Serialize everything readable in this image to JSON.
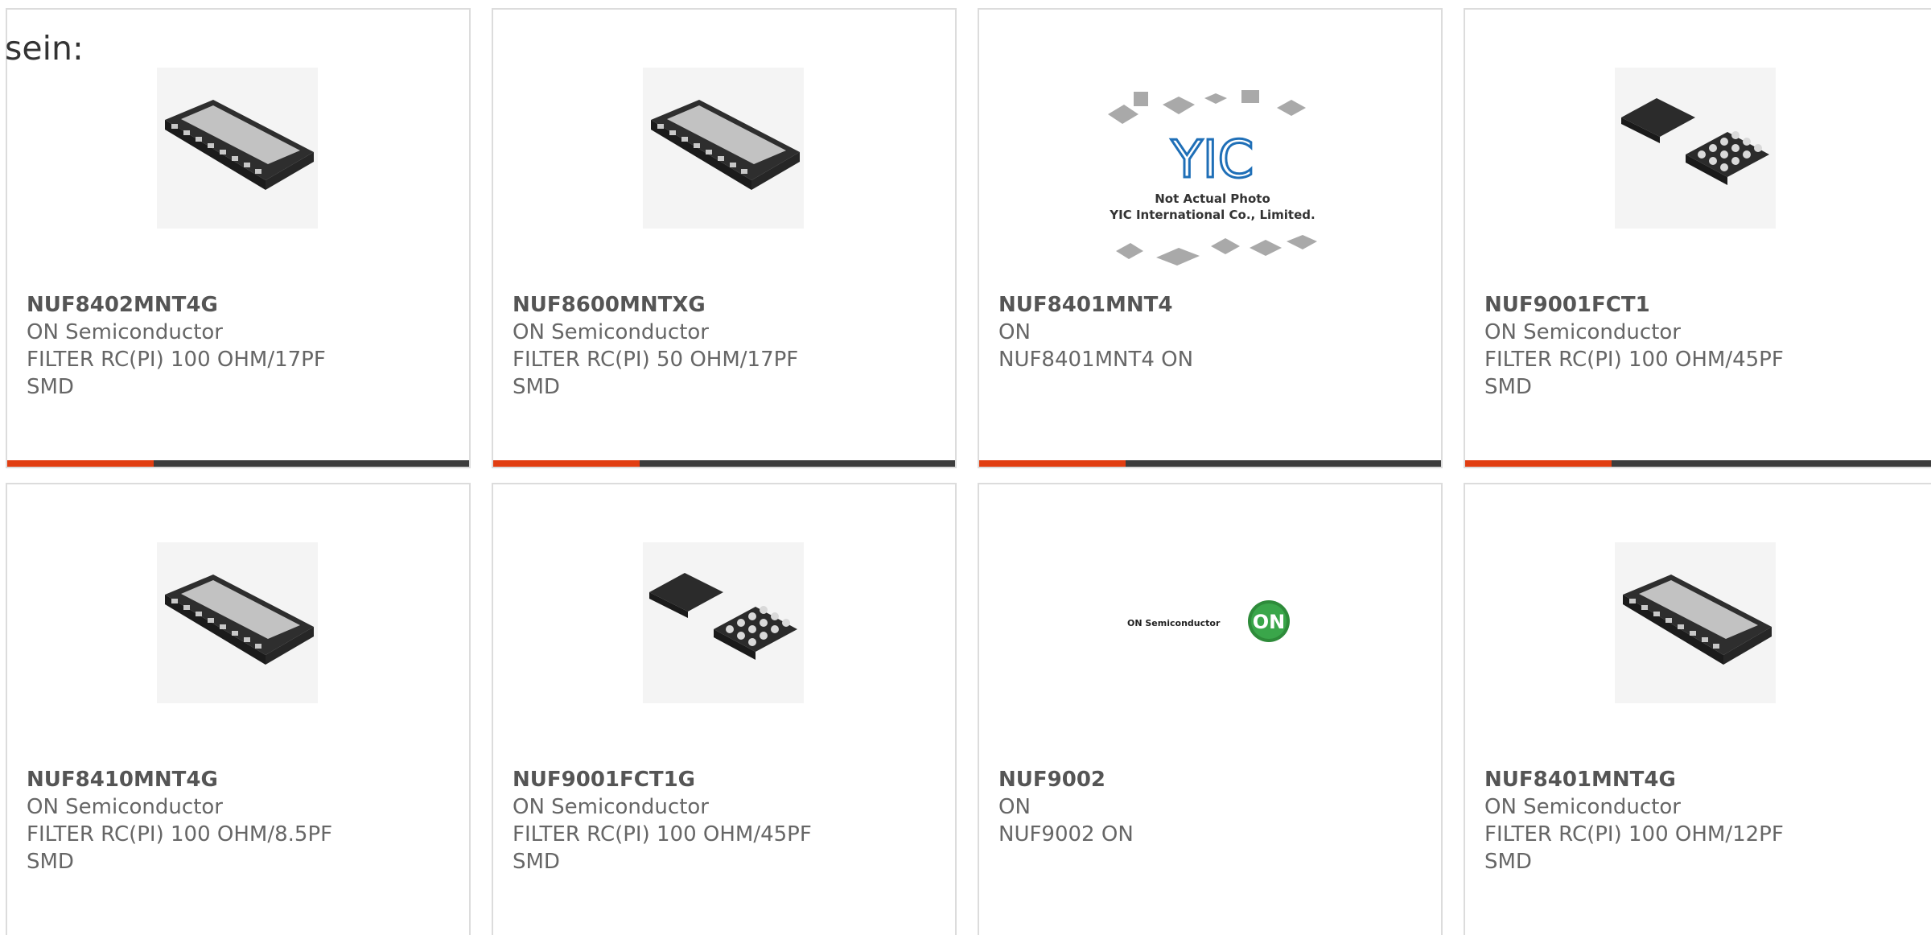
{
  "intro_text": "sein:",
  "colors": {
    "accent": "#e13e12",
    "bar_dark": "#3d3d3d",
    "text": "#666666",
    "border": "#dcdcdc"
  },
  "products": [
    {
      "part_number": "NUF8402MNT4G",
      "manufacturer": "ON Semiconductor",
      "description": "FILTER RC(PI) 100 OHM/17PF SMD",
      "image": "dfn-chip-image"
    },
    {
      "part_number": "NUF8600MNTXG",
      "manufacturer": "ON Semiconductor",
      "description": "FILTER RC(PI) 50 OHM/17PF SMD",
      "image": "dfn-chip-image"
    },
    {
      "part_number": "NUF8401MNT4",
      "manufacturer": "ON",
      "description": "NUF8401MNT4 ON",
      "image": "placeholder-image",
      "image_text": {
        "logo": "YIC",
        "line1": "Not Actual Photo",
        "line2": "YIC International Co., Limited."
      }
    },
    {
      "part_number": "NUF9001FCT1",
      "manufacturer": "ON Semiconductor",
      "description": "FILTER RC(PI) 100 OHM/45PF SMD",
      "image": "bga-chip-image"
    },
    {
      "part_number": "NUF8410MNT4G",
      "manufacturer": "ON Semiconductor",
      "description": "FILTER RC(PI) 100 OHM/8.5PF SMD",
      "image": "dfn-chip-image"
    },
    {
      "part_number": "NUF9001FCT1G",
      "manufacturer": "ON Semiconductor",
      "description": "FILTER RC(PI) 100 OHM/45PF SMD",
      "image": "bga-chip-image"
    },
    {
      "part_number": "NUF9002",
      "manufacturer": "ON",
      "description": "NUF9002 ON",
      "image": "on-semiconductor-logo",
      "image_text": {
        "wordmark": "ON Semiconductor",
        "badge": "ON"
      }
    },
    {
      "part_number": "NUF8401MNT4G",
      "manufacturer": "ON Semiconductor",
      "description": "FILTER RC(PI) 100 OHM/12PF SMD",
      "image": "dfn-chip-image"
    }
  ]
}
